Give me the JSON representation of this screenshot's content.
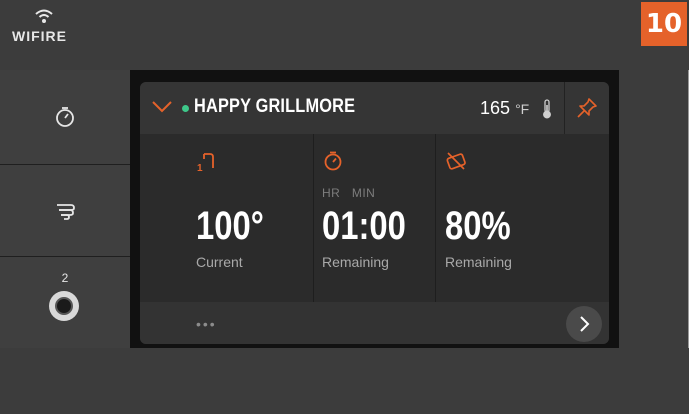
{
  "brand": {
    "name": "WIFIRE",
    "icon": "wifi-icon"
  },
  "step_badge": "10",
  "rail": {
    "items": [
      {
        "name": "timer",
        "icon": "timer-icon"
      },
      {
        "name": "smoke",
        "icon": "smoke-icon"
      },
      {
        "name": "probe",
        "icon": "probe-jack-icon",
        "label": "2"
      }
    ]
  },
  "grill": {
    "name": "HAPPY GRILLMORE",
    "temperature": "165",
    "unit": "°F",
    "status_color": "#3ec88a",
    "collapse_icon": "chevron-down-icon",
    "pin_icon": "pin-icon"
  },
  "stats": [
    {
      "icon": "probe-1-icon",
      "value": "100°",
      "label": "Current"
    },
    {
      "icon": "timer-icon",
      "sublabel": "HR   MIN",
      "value": "01:00",
      "label": "Remaining"
    },
    {
      "icon": "pellet-icon",
      "value": "80%",
      "label": "Remaining"
    }
  ],
  "footer": {
    "more": "•••",
    "next_icon": "chevron-right-icon"
  },
  "colors": {
    "accent": "#e5622a",
    "status": "#3ec88a"
  }
}
